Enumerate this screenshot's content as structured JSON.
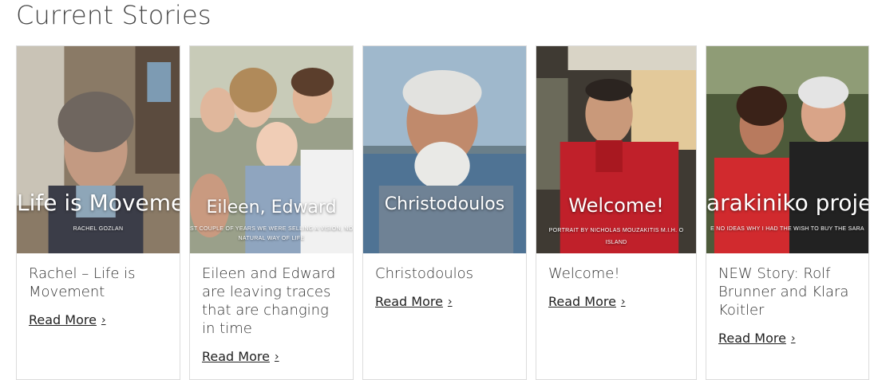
{
  "page": {
    "title": "Current Stories"
  },
  "cards": [
    {
      "image_title": "Life is Movemen",
      "image_subtitle": "RACHEL GOZLAN",
      "image_subtitle2": "",
      "title": "Rachel – Life is Movement",
      "read_more": "Read More",
      "chevron": "›"
    },
    {
      "image_title": "Eileen, Edward",
      "image_subtitle": "ST COUPLE OF YEARS WE WERE SELLING A VISION, NOW WE'RE S",
      "image_subtitle2": "NATURAL WAY OF LIFE",
      "title": "Eileen and Edward are leaving traces that are changing in time",
      "read_more": "Read More",
      "chevron": "›"
    },
    {
      "image_title": "Christodoulos",
      "image_subtitle": "",
      "image_subtitle2": "",
      "title": "Christodoulos",
      "read_more": "Read More",
      "chevron": "›"
    },
    {
      "image_title": "Welcome!",
      "image_subtitle": "PORTRAIT BY NICHOLAS MOUZAKITIS M.I.H. O",
      "image_subtitle2": "ISLAND",
      "title": "Welcome!",
      "read_more": "Read More",
      "chevron": "›"
    },
    {
      "image_title": "arakiniko projec",
      "image_subtitle": "E NO IDEAS WHY I HAD THE WISH TO BUY THE SARA",
      "image_subtitle2": "",
      "title": "NEW Story: Rolf Brunner and Klara Koitler",
      "read_more": "Read More",
      "chevron": "›"
    }
  ]
}
